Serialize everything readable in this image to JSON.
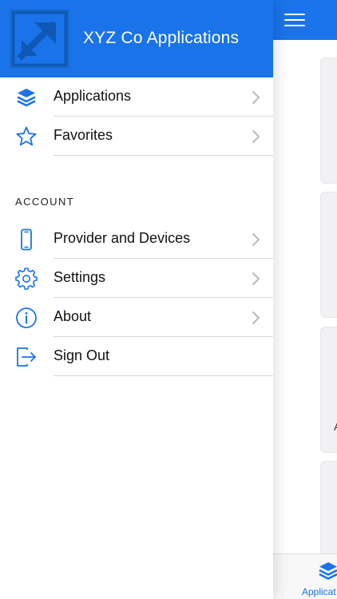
{
  "app": {
    "title": "XYZ Co Applications"
  },
  "drawer": {
    "primary_items": [
      {
        "label": "Applications",
        "icon": "layers-icon"
      },
      {
        "label": "Favorites",
        "icon": "star-icon"
      }
    ],
    "section_label": "ACCOUNT",
    "account_items": [
      {
        "label": "Provider and Devices",
        "icon": "phone-icon"
      },
      {
        "label": "Settings",
        "icon": "gear-icon"
      },
      {
        "label": "About",
        "icon": "info-icon"
      },
      {
        "label": "Sign Out",
        "icon": "sign-out-icon"
      }
    ]
  },
  "background": {
    "card_fragment": "A",
    "tab_label": "Applicat"
  },
  "colors": {
    "brand": "#1a73e8",
    "separator": "#d8d8dc",
    "chevron": "#b8b8bd"
  }
}
